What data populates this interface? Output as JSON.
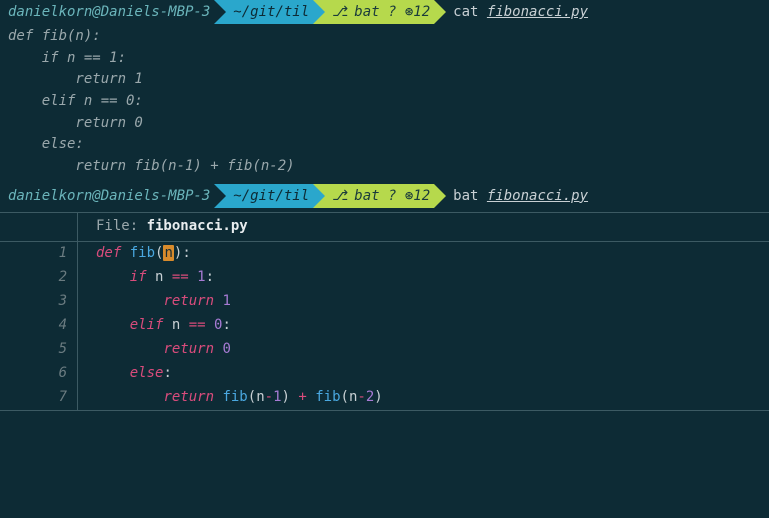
{
  "prompt1": {
    "userhost": "danielkorn@Daniels-MBP-3",
    "path": "~/git/til",
    "branch_icon": "⎇",
    "branch": "bat ? ⊛12",
    "command": "cat",
    "filename": "fibonacci.py"
  },
  "cat_output": "def fib(n):\n    if n == 1:\n        return 1\n    elif n == 0:\n        return 0\n    else:\n        return fib(n-1) + fib(n-2)",
  "prompt2": {
    "userhost": "danielkorn@Daniels-MBP-3",
    "path": "~/git/til",
    "branch_icon": "⎇",
    "branch": "bat ? ⊛12",
    "command": "bat",
    "filename": "fibonacci.py"
  },
  "bat": {
    "file_label": "File: ",
    "file_name": "fibonacci.py",
    "lines": {
      "n1": "1",
      "n2": "2",
      "n3": "3",
      "n4": "4",
      "n5": "5",
      "n6": "6",
      "n7": "7"
    },
    "code": {
      "l1": {
        "kw": "def ",
        "fn": "fib",
        "lp": "(",
        "param": "n",
        "rp": ")",
        "colon": ":"
      },
      "l2": {
        "indent": "    ",
        "kw": "if ",
        "var": "n",
        "op": " == ",
        "num": "1",
        "colon": ":"
      },
      "l3": {
        "indent": "        ",
        "kw": "return ",
        "num": "1"
      },
      "l4": {
        "indent": "    ",
        "kw": "elif ",
        "var": "n",
        "op": " == ",
        "num": "0",
        "colon": ":"
      },
      "l5": {
        "indent": "        ",
        "kw": "return ",
        "num": "0"
      },
      "l6": {
        "indent": "    ",
        "kw": "else",
        "colon": ":"
      },
      "l7": {
        "indent": "        ",
        "kw": "return ",
        "fn1": "fib",
        "lp1": "(",
        "v1": "n",
        "op1": "-",
        "n1": "1",
        "rp1": ")",
        "plus": " + ",
        "fn2": "fib",
        "lp2": "(",
        "v2": "n",
        "op2": "-",
        "n2": "2",
        "rp2": ")"
      }
    }
  }
}
